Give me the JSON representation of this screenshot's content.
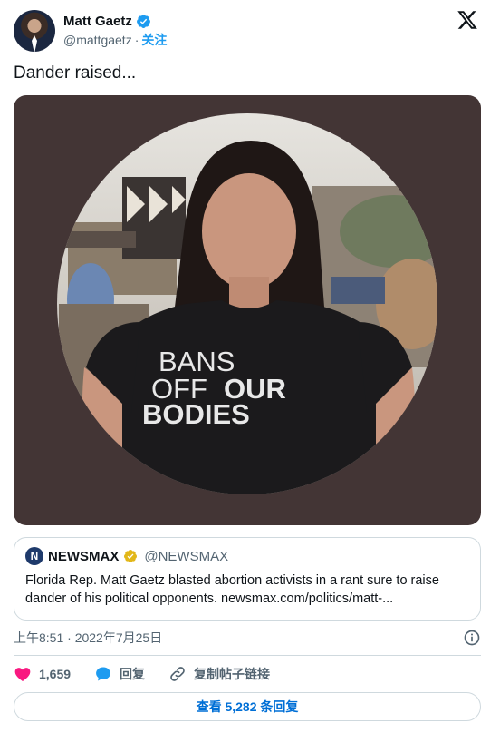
{
  "author": {
    "display_name": "Matt Gaetz",
    "handle": "@mattgaetz",
    "separator": "·",
    "follow_label": "关注"
  },
  "tweet": {
    "text": "Dander raised..."
  },
  "media": {
    "shirt_line1": "BANS",
    "shirt_line2a": "OFF",
    "shirt_line2b": "OUR",
    "shirt_line3": "BODIES"
  },
  "quote": {
    "name": "NEWSMAX",
    "logo_letter": "N",
    "handle": "@NEWSMAX",
    "body_line1": "Florida Rep. Matt Gaetz blasted abortion activists in a rant sure to raise",
    "body_line2": "dander of his political opponents.  newsmax.com/politics/matt-..."
  },
  "meta": {
    "timestamp": "上午8:51 · 2022年7月25日"
  },
  "actions": {
    "like_count": "1,659",
    "reply_label": "回复",
    "copy_link_label": "复制帖子链接"
  },
  "replies_button": {
    "label": "查看 5,282 条回复"
  },
  "colors": {
    "brand_blue": "#1d9bf0",
    "like_pink": "#f91880",
    "media_bg": "#433535",
    "gold_badge": "#e2b719"
  }
}
